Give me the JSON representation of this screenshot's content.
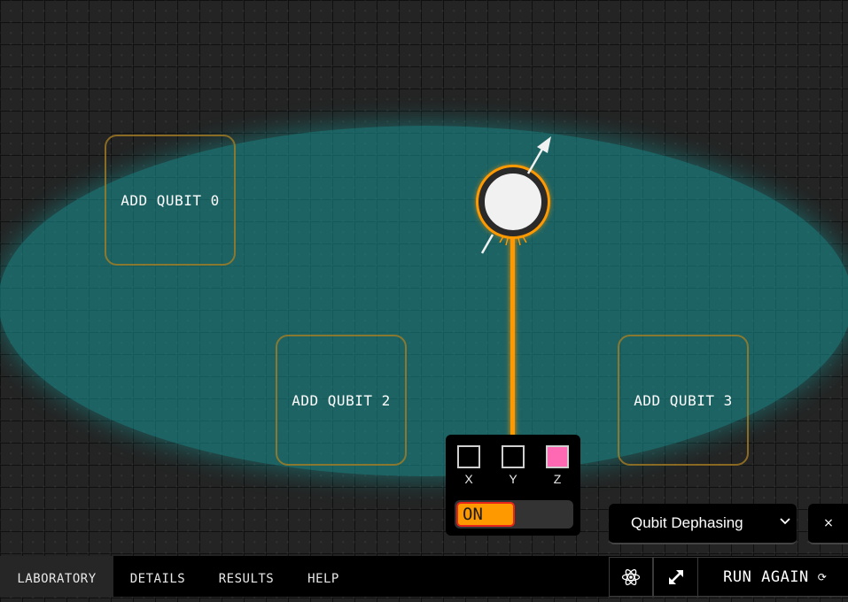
{
  "colors": {
    "accent": "#ff9900",
    "teal_field": "#189191",
    "active_gate": "#ff69b4",
    "toggle_border": "#e8251c",
    "background": "#242424"
  },
  "slots": {
    "qubit_0": "ADD QUBIT 0",
    "qubit_2": "ADD QUBIT 2",
    "qubit_3": "ADD QUBIT 3"
  },
  "gate_panel": {
    "gates": [
      {
        "label": "X",
        "active": false
      },
      {
        "label": "Y",
        "active": false
      },
      {
        "label": "Z",
        "active": true
      }
    ],
    "toggle_label": "ON"
  },
  "noise_select": {
    "value": "Qubit Dephasing",
    "icon": "chevron-down-icon"
  },
  "close_button": {
    "label": "×"
  },
  "tabs": [
    {
      "label": "LABORATORY",
      "active": true
    },
    {
      "label": "DETAILS",
      "active": false
    },
    {
      "label": "RESULTS",
      "active": false
    },
    {
      "label": "HELP",
      "active": false
    }
  ],
  "toolbar": {
    "atom_icon": "atom-icon",
    "expand_icon": "expand-arrows-icon",
    "run_label": "RUN AGAIN",
    "run_icon": "⟳"
  }
}
